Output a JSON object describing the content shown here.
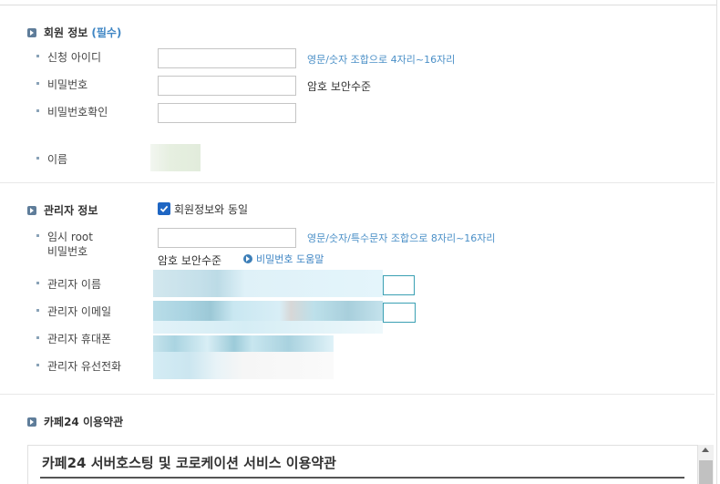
{
  "member_info": {
    "title": "회원 정보",
    "required": "(필수)",
    "fields": {
      "id_label": "신청 아이디",
      "id_hint": "영문/숫자 조합으로 4자리~16자리",
      "password_label": "비밀번호",
      "password_strength": "암호 보안수준",
      "password_confirm_label": "비밀번호확인",
      "name_label": "이름"
    }
  },
  "admin_info": {
    "title": "관리자 정보",
    "same_as_member_label": "회원정보와 동일",
    "same_as_member_checked": true,
    "temp_root_label_1": "임시 root",
    "temp_root_label_2": "비밀번호",
    "temp_root_hint": "영문/숫자/특수문자 조합으로 8자리~16자리",
    "temp_root_strength": "암호 보안수준",
    "password_help_link": "비밀번호 도움말",
    "admin_name_label": "관리자 이름",
    "admin_email_label": "관리자 이메일",
    "admin_mobile_label": "관리자 휴대폰",
    "admin_phone_label": "관리자 유선전화"
  },
  "terms": {
    "section_title": "카페24 이용약관",
    "box_title": "카페24 서버호스팅 및 코로케이션 서비스 이용약관"
  },
  "colors": {
    "accent_link": "#3f86c4",
    "section_bullet": "#5f7d9a",
    "checkbox": "#1f66c3"
  },
  "icons": {
    "section_bullet": "play-square-icon",
    "help_link": "play-circle-icon",
    "checkbox": "checkmark-icon",
    "scroll_up": "caret-up-icon"
  }
}
